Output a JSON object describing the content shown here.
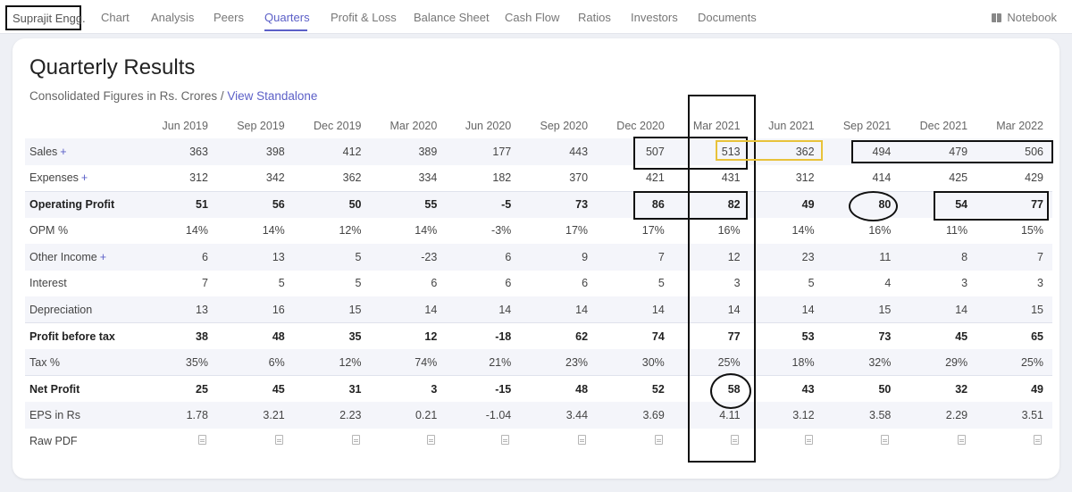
{
  "nav": {
    "company": "Suprajit Engg.",
    "items": [
      {
        "label": "Chart",
        "active": false
      },
      {
        "label": "Analysis",
        "active": false
      },
      {
        "label": "Peers",
        "active": false
      },
      {
        "label": "Quarters",
        "active": true
      },
      {
        "label": "Profit & Loss",
        "active": false
      },
      {
        "label": "Balance Sheet",
        "active": false
      },
      {
        "label": "Cash Flow",
        "active": false
      },
      {
        "label": "Ratios",
        "active": false
      },
      {
        "label": "Investors",
        "active": false
      },
      {
        "label": "Documents",
        "active": false
      }
    ],
    "notebook": "Notebook",
    "accent_color": "#5b5fc7"
  },
  "section": {
    "title": "Quarterly Results",
    "subtitle": "Consolidated Figures in Rs. Crores / ",
    "standalone_link": "View Standalone"
  },
  "table": {
    "columns": [
      "Jun 2019",
      "Sep 2019",
      "Dec 2019",
      "Mar 2020",
      "Jun 2020",
      "Sep 2020",
      "Dec 2020",
      "Mar 2021",
      "Jun 2021",
      "Sep 2021",
      "Dec 2021",
      "Mar 2022"
    ],
    "rows": [
      {
        "label": "Sales",
        "plus": true,
        "bold": false,
        "values": [
          "363",
          "398",
          "412",
          "389",
          "177",
          "443",
          "507",
          "513",
          "362",
          "494",
          "479",
          "506"
        ]
      },
      {
        "label": "Expenses",
        "plus": true,
        "bold": false,
        "values": [
          "312",
          "342",
          "362",
          "334",
          "182",
          "370",
          "421",
          "431",
          "312",
          "414",
          "425",
          "429"
        ]
      },
      {
        "label": "Operating Profit",
        "plus": false,
        "bold": true,
        "values": [
          "51",
          "56",
          "50",
          "55",
          "-5",
          "73",
          "86",
          "82",
          "49",
          "80",
          "54",
          "77"
        ]
      },
      {
        "label": "OPM %",
        "plus": false,
        "bold": false,
        "values": [
          "14%",
          "14%",
          "12%",
          "14%",
          "-3%",
          "17%",
          "17%",
          "16%",
          "14%",
          "16%",
          "11%",
          "15%"
        ]
      },
      {
        "label": "Other Income",
        "plus": true,
        "bold": false,
        "values": [
          "6",
          "13",
          "5",
          "-23",
          "6",
          "9",
          "7",
          "12",
          "23",
          "11",
          "8",
          "7"
        ]
      },
      {
        "label": "Interest",
        "plus": false,
        "bold": false,
        "values": [
          "7",
          "5",
          "5",
          "6",
          "6",
          "6",
          "5",
          "3",
          "5",
          "4",
          "3",
          "3"
        ]
      },
      {
        "label": "Depreciation",
        "plus": false,
        "bold": false,
        "values": [
          "13",
          "16",
          "15",
          "14",
          "14",
          "14",
          "14",
          "14",
          "14",
          "15",
          "14",
          "15"
        ]
      },
      {
        "label": "Profit before tax",
        "plus": false,
        "bold": true,
        "values": [
          "38",
          "48",
          "35",
          "12",
          "-18",
          "62",
          "74",
          "77",
          "53",
          "73",
          "45",
          "65"
        ]
      },
      {
        "label": "Tax %",
        "plus": false,
        "bold": false,
        "values": [
          "35%",
          "6%",
          "12%",
          "74%",
          "21%",
          "23%",
          "30%",
          "25%",
          "18%",
          "32%",
          "29%",
          "25%"
        ]
      },
      {
        "label": "Net Profit",
        "plus": false,
        "bold": true,
        "values": [
          "25",
          "45",
          "31",
          "3",
          "-15",
          "48",
          "52",
          "58",
          "43",
          "50",
          "32",
          "49"
        ]
      },
      {
        "label": "EPS in Rs",
        "plus": false,
        "bold": false,
        "values": [
          "1.78",
          "3.21",
          "2.23",
          "0.21",
          "-1.04",
          "3.44",
          "3.69",
          "4.11",
          "3.12",
          "3.58",
          "2.29",
          "3.51"
        ]
      }
    ],
    "raw_pdf_label": "Raw PDF",
    "plus_symbol": "+"
  }
}
